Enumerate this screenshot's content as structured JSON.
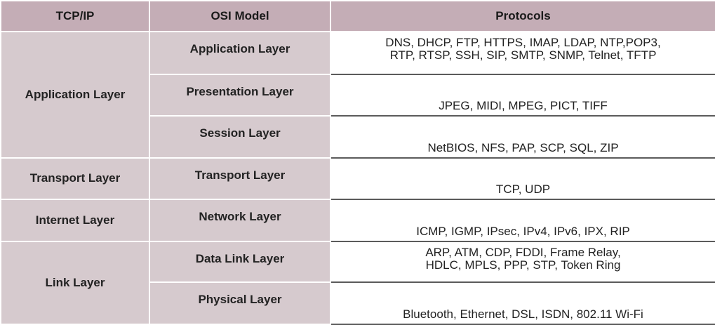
{
  "headers": [
    "TCP/IP",
    "OSI Model",
    "Protocols"
  ],
  "rows": [
    {
      "tcpip": "Application Layer",
      "osi": "Application Layer",
      "protocols": [
        "DNS, DHCP, FTP, HTTPS, IMAP, LDAP, NTP,POP3,",
        "RTP, RTSP, SSH, SIP, SMTP, SNMP, Telnet, TFTP"
      ]
    },
    {
      "osi": "Presentation Layer",
      "protocols": [
        "JPEG, MIDI, MPEG, PICT, TIFF"
      ]
    },
    {
      "osi": "Session Layer",
      "protocols": [
        "NetBIOS, NFS, PAP, SCP, SQL, ZIP"
      ]
    },
    {
      "tcpip": "Transport Layer",
      "osi": "Transport Layer",
      "protocols": [
        "TCP, UDP"
      ]
    },
    {
      "tcpip": "Internet Layer",
      "osi": "Network Layer",
      "protocols": [
        "ICMP, IGMP, IPsec, IPv4, IPv6,  IPX, RIP"
      ]
    },
    {
      "tcpip": "Link Layer",
      "osi": "Data Link Layer",
      "protocols": [
        "ARP, ATM, CDP, FDDI, Frame Relay,",
        "HDLC, MPLS, PPP, STP, Token Ring"
      ]
    },
    {
      "osi": "Physical Layer",
      "protocols": [
        "Bluetooth, Ethernet, DSL, ISDN, 802.11 Wi-Fi"
      ]
    }
  ]
}
